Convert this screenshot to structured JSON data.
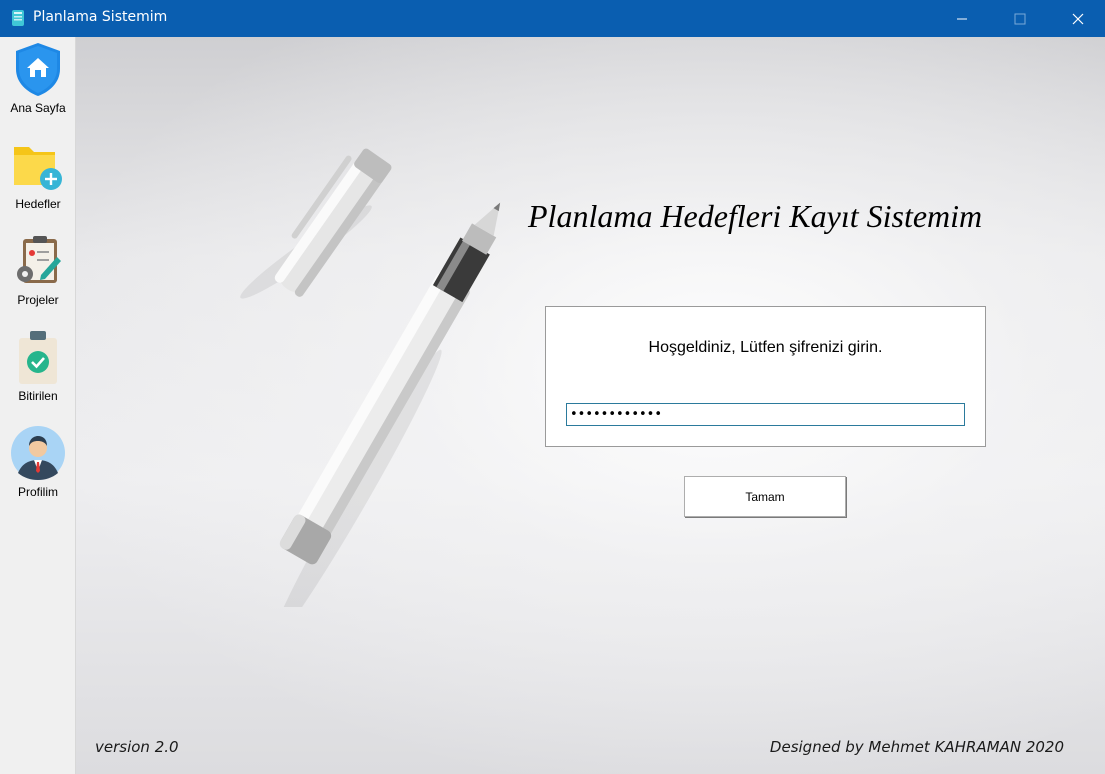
{
  "window": {
    "title": "Planlama Sistemim",
    "accent_color": "#0a5eb0"
  },
  "sidebar": {
    "items": [
      {
        "label": "Ana Sayfa",
        "icon": "home-shield-icon"
      },
      {
        "label": "Hedefler",
        "icon": "folder-add-icon"
      },
      {
        "label": "Projeler",
        "icon": "clipboard-gear-icon"
      },
      {
        "label": "Bitirilen",
        "icon": "clipboard-check-icon"
      },
      {
        "label": "Profilim",
        "icon": "user-avatar-icon"
      }
    ]
  },
  "main": {
    "heading": "Planlama Hedefleri Kayıt Sistemim",
    "login": {
      "welcome": "Hoşgeldiniz, Lütfen şifrenizi girin.",
      "password_value": "••••••••••••"
    },
    "ok_button": "Tamam",
    "version": "version 2.0",
    "designed_by": "Designed by Mehmet KAHRAMAN 2020"
  }
}
